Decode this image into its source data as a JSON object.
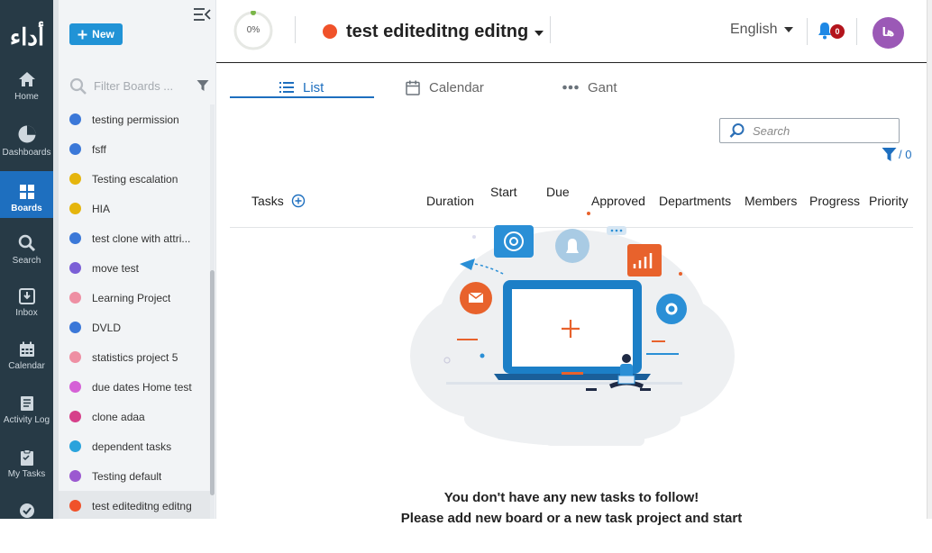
{
  "app": {
    "logo_text": "أداء"
  },
  "nav": [
    {
      "label": "Home",
      "icon": "home-icon"
    },
    {
      "label": "Dashboards",
      "icon": "pie-chart-icon"
    },
    {
      "label": "Boards",
      "icon": "boards-grid-icon",
      "active": true
    },
    {
      "label": "Search",
      "icon": "search-icon"
    },
    {
      "label": "Inbox",
      "icon": "inbox-icon"
    },
    {
      "label": "Calendar",
      "icon": "calendar-icon"
    },
    {
      "label": "Activity Log",
      "icon": "activity-log-icon"
    },
    {
      "label": "My Tasks",
      "icon": "clipboard-icon"
    }
  ],
  "boards_panel": {
    "new_label": "New",
    "filter_placeholder": "Filter Boards ...",
    "boards": [
      {
        "name": "testing permission",
        "color": "#3b78d8"
      },
      {
        "name": "fsff",
        "color": "#3b78d8"
      },
      {
        "name": "Testing escalation",
        "color": "#e5b50d"
      },
      {
        "name": "HIA",
        "color": "#e5b50d"
      },
      {
        "name": "test clone with attri...",
        "color": "#3b78d8"
      },
      {
        "name": "move test",
        "color": "#7b5fd6"
      },
      {
        "name": "Learning Project",
        "color": "#ee8fa3"
      },
      {
        "name": "DVLD",
        "color": "#3b78d8"
      },
      {
        "name": "statistics project 5",
        "color": "#ee8fa3"
      },
      {
        "name": "due dates Home test",
        "color": "#d561d6"
      },
      {
        "name": "clone adaa",
        "color": "#d6408a"
      },
      {
        "name": "dependent tasks",
        "color": "#2aa3dc"
      },
      {
        "name": "Testing default",
        "color": "#9b59d0"
      },
      {
        "name": "test editeditng editng",
        "color": "#f0522a",
        "selected": true
      }
    ]
  },
  "header": {
    "progress_text": "0%",
    "progress_color": "#7ab648",
    "project_title": "test editeditng editng",
    "project_color": "#f0522a",
    "language": "English",
    "notification_count": "0",
    "avatar_initials": "ها",
    "avatar_color": "#9b59b6"
  },
  "tabs": [
    {
      "label": "List",
      "icon": "list-icon",
      "active": true
    },
    {
      "label": "Calendar",
      "icon": "calendar-icon"
    },
    {
      "label": "Gant",
      "icon": "gantt-dots-icon"
    }
  ],
  "task_search": {
    "placeholder": "Search",
    "filter_count": "/ 0"
  },
  "columns": {
    "tasks": "Tasks",
    "duration": "Duration",
    "start": "Start",
    "due": "Due",
    "approved": "Approved",
    "departments": "Departments",
    "members": "Members",
    "progress": "Progress",
    "priority": "Priority"
  },
  "empty_state": {
    "title": "You don't have any new tasks to follow!",
    "subtitle": "Please add new board or a new task project and start"
  },
  "colors": {
    "rail_bg": "#273a46",
    "accent": "#1e6fbf",
    "new_button": "#2193d6",
    "badge": "#b3141c"
  }
}
